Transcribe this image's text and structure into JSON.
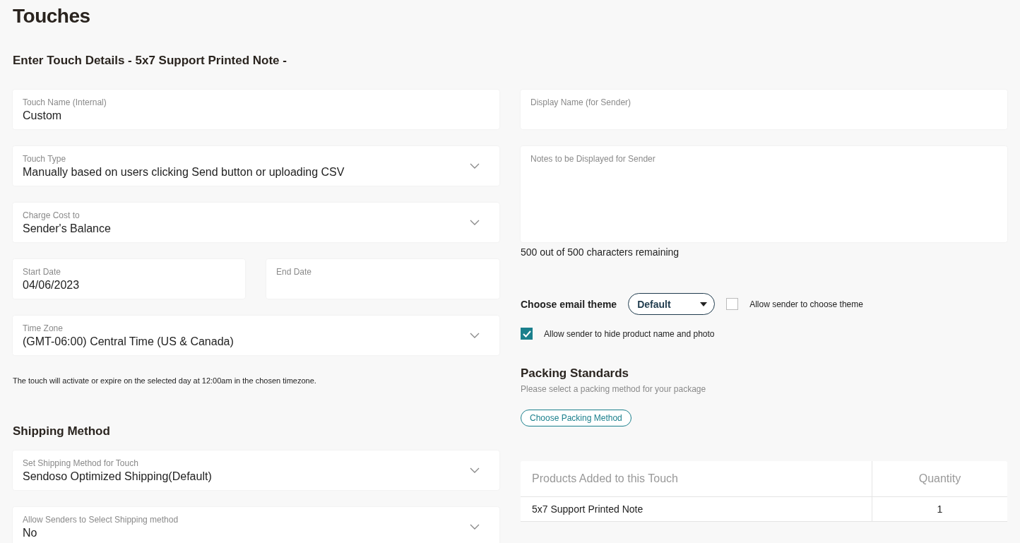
{
  "page_title": "Touches",
  "section_title": "Enter Touch Details - 5x7 Support Printed Note -",
  "details": [
    {
      "kind": "text",
      "label": "Touch Name (Internal)",
      "value": "Custom"
    },
    {
      "kind": "select",
      "label": "Touch Type",
      "value": "Manually based on users clicking Send button or uploading CSV"
    },
    {
      "kind": "select",
      "label": "Charge Cost to",
      "value": "Sender's Balance"
    },
    {
      "kind": "pair",
      "fields": [
        {
          "label": "Start Date",
          "value": "04/06/2023"
        },
        {
          "label": "End Date"
        }
      ]
    },
    {
      "kind": "select",
      "label": "Time Zone",
      "value": "(GMT-06:00) Central Time (US & Canada)"
    }
  ],
  "timezone_note": "The touch will activate or expire on the selected day at 12:00am in the chosen timezone.",
  "shipping": {
    "title": "Shipping Method",
    "fields": [
      {
        "kind": "select",
        "label": "Set Shipping Method for Touch",
        "value": "Sendoso Optimized Shipping(Default)"
      },
      {
        "kind": "select",
        "label": "Allow Senders to Select Shipping method",
        "value": "No"
      }
    ]
  },
  "display_name": {
    "label": "Display Name (for Sender)"
  },
  "notes": {
    "label": "Notes to be Displayed for Sender",
    "counter": "500 out of 500 characters remaining"
  },
  "email_theme": {
    "label": "Choose email theme",
    "value": "Default"
  },
  "options": [
    {
      "label": "Allow sender to choose theme",
      "checked": false
    },
    {
      "label": "Allow sender to hide product name and photo",
      "checked": true
    }
  ],
  "packing": {
    "title": "Packing Standards",
    "subtitle": "Please select a packing method for your package",
    "button": "Choose Packing Method"
  },
  "products_table": {
    "columns": [
      "Products Added to this Touch",
      "Quantity"
    ],
    "rows": [
      [
        "5x7 Support Printed Note",
        "1"
      ]
    ]
  }
}
